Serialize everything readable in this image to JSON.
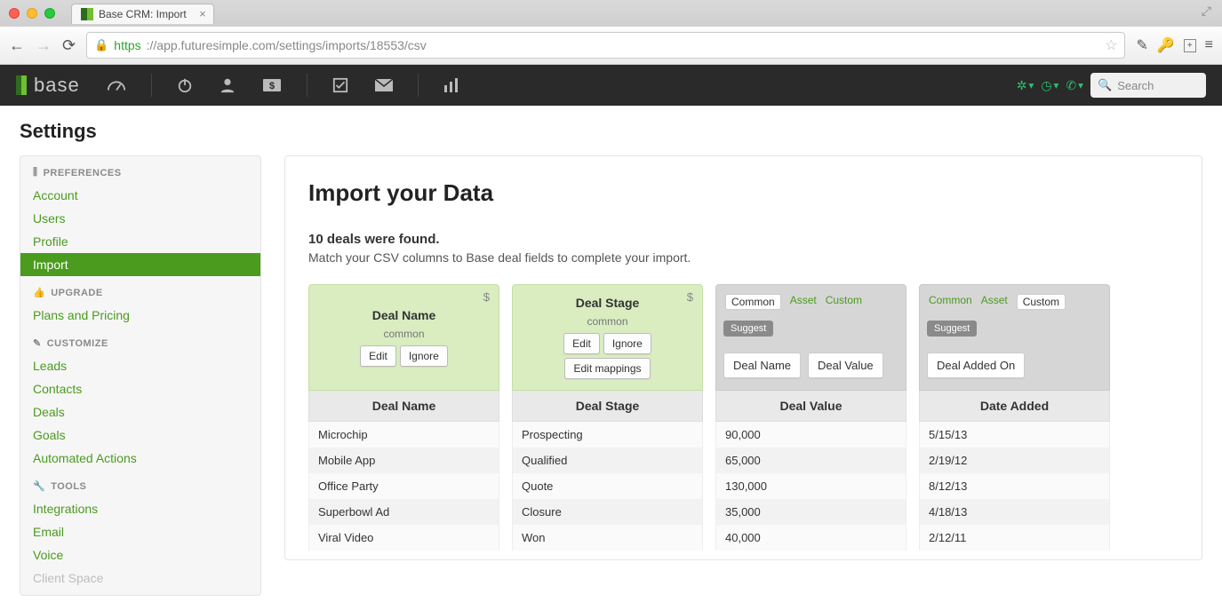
{
  "browser": {
    "tab_title": "Base CRM: Import",
    "url_proto": "https",
    "url_rest": "://app.futuresimple.com/settings/imports/18553/csv"
  },
  "search_placeholder": "Search",
  "page_title": "Settings",
  "sidebar": {
    "groups": [
      {
        "header": "PREFERENCES",
        "icon": "sliders",
        "items": [
          {
            "label": "Account"
          },
          {
            "label": "Users"
          },
          {
            "label": "Profile"
          },
          {
            "label": "Import",
            "active": true
          }
        ]
      },
      {
        "header": "UPGRADE",
        "icon": "thumbs-up",
        "items": [
          {
            "label": "Plans and Pricing"
          }
        ]
      },
      {
        "header": "CUSTOMIZE",
        "icon": "pencil",
        "items": [
          {
            "label": "Leads"
          },
          {
            "label": "Contacts"
          },
          {
            "label": "Deals"
          },
          {
            "label": "Goals"
          },
          {
            "label": "Automated Actions"
          }
        ]
      },
      {
        "header": "TOOLS",
        "icon": "wrench",
        "items": [
          {
            "label": "Integrations"
          },
          {
            "label": "Email"
          },
          {
            "label": "Voice"
          },
          {
            "label": "Client Space",
            "muted": true
          }
        ]
      }
    ]
  },
  "main": {
    "title": "Import your Data",
    "found_line": "10 deals were found.",
    "help_line": "Match your CSV columns to Base deal fields to complete your import.",
    "buttons": {
      "edit": "Edit",
      "ignore": "Ignore",
      "edit_mappings": "Edit mappings",
      "suggest": "Suggest"
    },
    "tabs": {
      "common": "Common",
      "asset": "Asset",
      "custom": "Custom"
    },
    "common_label": "common",
    "columns": [
      {
        "type": "mapped",
        "map_title": "Deal Name",
        "header": "Deal Name",
        "actions": [
          "edit",
          "ignore"
        ],
        "rows": [
          "Microchip",
          "Mobile App",
          "Office Party",
          "Superbowl Ad",
          "Viral Video"
        ]
      },
      {
        "type": "mapped",
        "map_title": "Deal Stage",
        "header": "Deal Stage",
        "actions": [
          "edit",
          "ignore",
          "edit_mappings"
        ],
        "rows": [
          "Prospecting",
          "Qualified",
          "Quote",
          "Closure",
          "Won"
        ]
      },
      {
        "type": "unmapped",
        "active_tab": "common",
        "chips": [
          "Deal Name",
          "Deal Value"
        ],
        "header": "Deal Value",
        "rows": [
          "90,000",
          "65,000",
          "130,000",
          "35,000",
          "40,000"
        ]
      },
      {
        "type": "unmapped",
        "active_tab": "custom",
        "chips": [
          "Deal Added On"
        ],
        "header": "Date Added",
        "rows": [
          "5/15/13",
          "2/19/12",
          "8/12/13",
          "4/18/13",
          "2/12/11"
        ]
      }
    ]
  }
}
